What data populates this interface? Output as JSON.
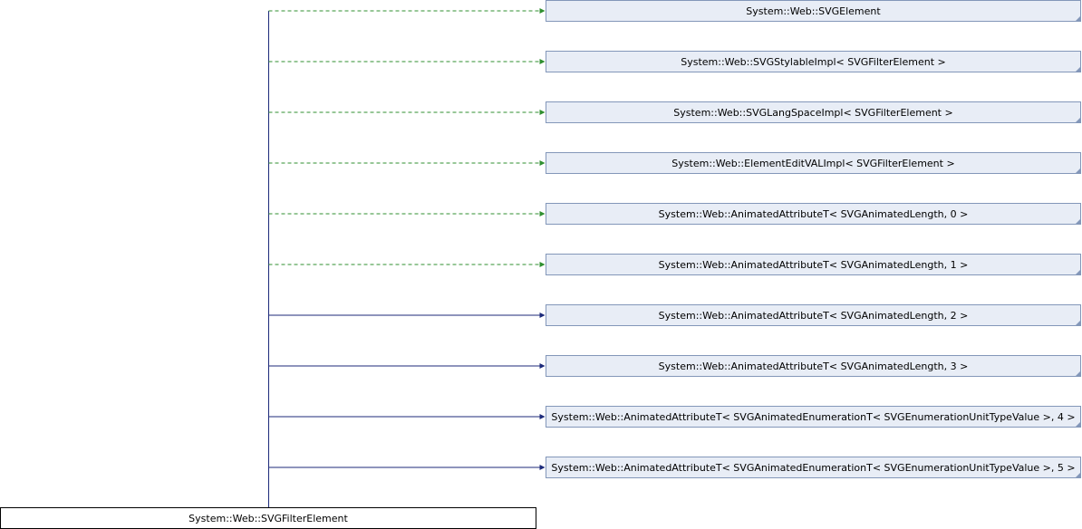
{
  "diagram": {
    "derived_class": "System::Web::SVGFilterElement",
    "base_classes": [
      {
        "label": "System::Web::SVGElement",
        "relation": "dashed"
      },
      {
        "label": "System::Web::SVGStylableImpl< SVGFilterElement >",
        "relation": "dashed"
      },
      {
        "label": "System::Web::SVGLangSpaceImpl< SVGFilterElement >",
        "relation": "dashed"
      },
      {
        "label": "System::Web::ElementEditVALImpl< SVGFilterElement >",
        "relation": "dashed"
      },
      {
        "label": "System::Web::AnimatedAttributeT< SVGAnimatedLength, 0 >",
        "relation": "dashed"
      },
      {
        "label": "System::Web::AnimatedAttributeT< SVGAnimatedLength, 1 >",
        "relation": "dashed"
      },
      {
        "label": "System::Web::AnimatedAttributeT< SVGAnimatedLength, 2 >",
        "relation": "solid"
      },
      {
        "label": "System::Web::AnimatedAttributeT< SVGAnimatedLength, 3 >",
        "relation": "solid"
      },
      {
        "label": "System::Web::AnimatedAttributeT< SVGAnimatedEnumerationT< SVGEnumerationUnitTypeValue >, 4 >",
        "relation": "solid"
      },
      {
        "label": "System::Web::AnimatedAttributeT< SVGAnimatedEnumerationT< SVGEnumerationUnitTypeValue >, 5 >",
        "relation": "solid"
      }
    ]
  }
}
